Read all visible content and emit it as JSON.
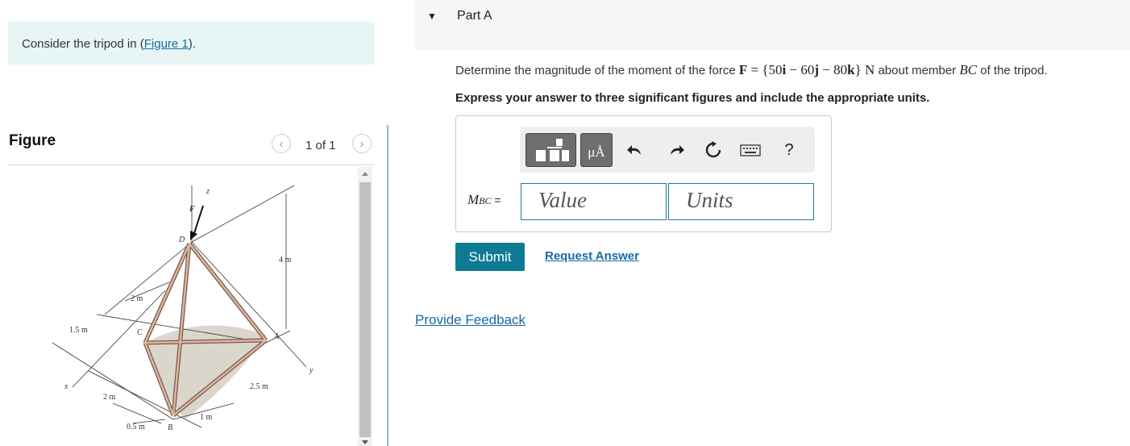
{
  "intro": {
    "prefix": "Consider the tripod in (",
    "link": "Figure 1",
    "suffix": ")."
  },
  "figure": {
    "title": "Figure",
    "pager": "1 of 1",
    "labels": {
      "z": "z",
      "F": "F",
      "D": "D",
      "C": "C",
      "A": "A",
      "B": "B",
      "x": "x",
      "y": "y",
      "h4": "4 m",
      "d2a": "2 m",
      "d15": "1.5 m",
      "d2b": "2 m",
      "d05": "0.5 m",
      "d1": "1 m",
      "d25": "2.5 m"
    }
  },
  "part": {
    "label": "Part A"
  },
  "question": {
    "t1": "Determine the magnitude of the moment of the force ",
    "F": "F",
    "eq": " = ",
    "brace_open": "{",
    "n50": "50",
    "i": "i",
    "minus1": " − ",
    "n60": "60",
    "j": "j",
    "minus2": " − ",
    "n80": "80",
    "k": "k",
    "brace_close": "}",
    "N": " N",
    "t2": " about member ",
    "BC": "BC",
    "t3": " of the tripod."
  },
  "instruction": "Express your answer to three significant figures and include the appropriate units.",
  "toolbar": {
    "units_glyph": "μÅ",
    "help": "?"
  },
  "answer": {
    "var_main": "M",
    "var_sub": "BC",
    "eq": " =",
    "value_placeholder": "Value",
    "units_placeholder": "Units"
  },
  "buttons": {
    "submit": "Submit",
    "request": "Request Answer"
  },
  "feedback": "Provide Feedback",
  "colors": {
    "accent": "#0e7a93",
    "link": "#1a6aa6",
    "intro_bg": "#e8f5f5",
    "field_border": "#1c7d9a"
  }
}
